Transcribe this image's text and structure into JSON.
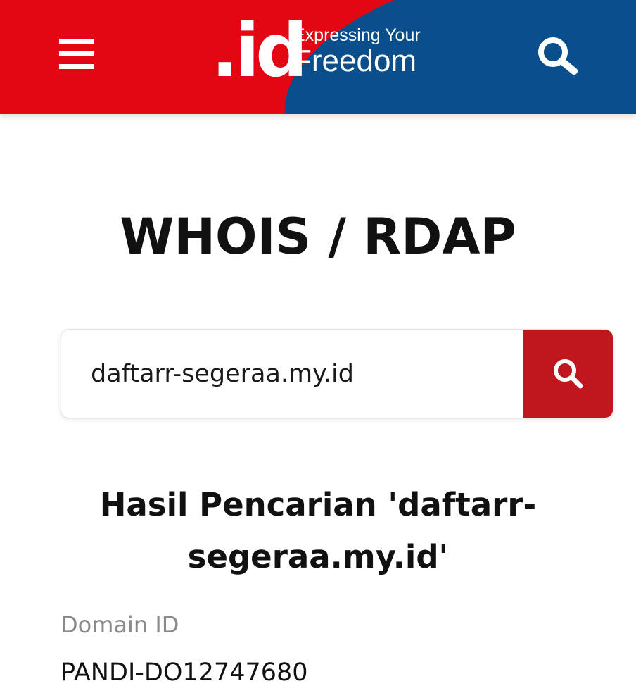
{
  "header": {
    "logo_mark": ".id",
    "tagline_line1": "Expressing Your",
    "tagline_line2": "Freedom",
    "colors": {
      "red": "#e30613",
      "blue": "#0a4f8c"
    },
    "menu_icon": "hamburger-icon",
    "search_icon": "search-icon"
  },
  "page": {
    "title": "WHOIS / RDAP"
  },
  "search": {
    "value": "daftarr-segeraa.my.id",
    "button_icon": "search-icon",
    "button_color": "#c0161d"
  },
  "result": {
    "title": "Hasil Pencarian 'daftarr-segeraa.my.id'",
    "fields": [
      {
        "label": "Domain ID",
        "value": "PANDI-DO12747680"
      }
    ]
  }
}
